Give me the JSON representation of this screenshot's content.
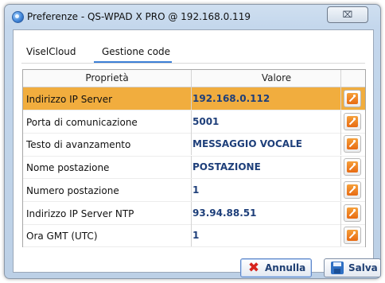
{
  "window": {
    "title": "Preferenze - QS-WPAD X PRO @ 192.168.0.119",
    "close_glyph": "⌧",
    "icon": "app-logo-icon"
  },
  "tabs": [
    {
      "label": "ViselCloud",
      "active": false
    },
    {
      "label": "Gestione code",
      "active": true
    }
  ],
  "grid": {
    "columns": [
      "Proprietà",
      "Valore"
    ],
    "rows": [
      {
        "name": "Indirizzo IP Server",
        "value": "192.168.0.112",
        "selected": true
      },
      {
        "name": "Porta di comunicazione",
        "value": "5001",
        "selected": false
      },
      {
        "name": "Testo di avanzamento",
        "value": "MESSAGGIO VOCALE",
        "selected": false
      },
      {
        "name": "Nome postazione",
        "value": "POSTAZIONE",
        "selected": false
      },
      {
        "name": "Numero postazione",
        "value": "1",
        "selected": false
      },
      {
        "name": "Indirizzo IP Server NTP",
        "value": "93.94.88.51",
        "selected": false
      },
      {
        "name": "Ora GMT (UTC)",
        "value": "1",
        "selected": false
      }
    ],
    "edit_icon": "wrench-edit-icon"
  },
  "footer": {
    "cancel_label": "Annulla",
    "save_label": "Salva",
    "colors": {
      "selected_row": "#f1ad3e",
      "value_text": "#1e3f7a",
      "cancel_icon": "#d7231d",
      "save_icon": "#2f6fc3"
    }
  }
}
